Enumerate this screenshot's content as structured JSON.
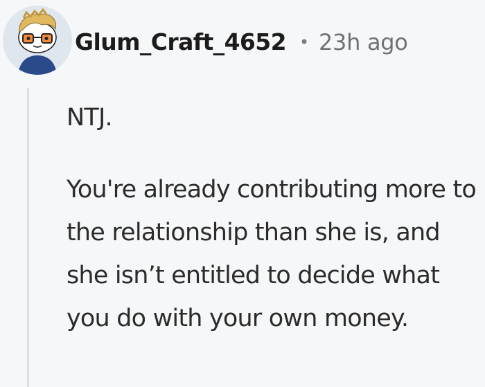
{
  "comment": {
    "author": "Glum_Craft_4652",
    "separator": "•",
    "timestamp": "23h ago",
    "avatar_icon": "snoo-avatar-icon",
    "paragraphs": [
      "NTJ.",
      "You're already contributing more to the relationship than she is, and she isn’t entitled to decide what you do with your own money."
    ]
  },
  "colors": {
    "background": "#f6f7f8",
    "text": "#2b2b2b",
    "username": "#1c1c1c",
    "meta": "#6f7173",
    "thread_line": "#dcdde0"
  }
}
